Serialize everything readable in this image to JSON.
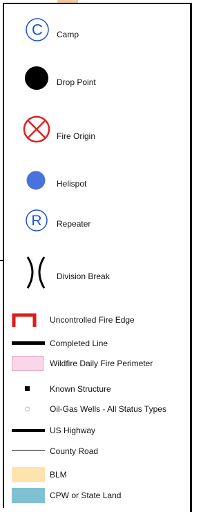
{
  "legend": {
    "items": [
      {
        "label": "Camp",
        "icon": "camp-c-circle-icon",
        "color": "#1f4fd6"
      },
      {
        "label": "Drop Point",
        "icon": "black-dot-icon",
        "color": "#000000"
      },
      {
        "label": "Fire Origin",
        "icon": "fire-origin-icon",
        "color": "#e02020"
      },
      {
        "label": "Helispot",
        "icon": "blue-dot-icon",
        "color": "#4a72dc"
      },
      {
        "label": "Repeater",
        "icon": "repeater-r-circle-icon",
        "color": "#1f4fd6"
      },
      {
        "label": "Division Break",
        "icon": "division-break-icon",
        "color": "#000000"
      },
      {
        "label": "Uncontrolled Fire Edge",
        "icon": "uncontrolled-edge-icon",
        "color": "#dd1c1c"
      },
      {
        "label": "Completed Line",
        "icon": "completed-line-icon",
        "color": "#000000"
      },
      {
        "label": "Wildfire Daily Fire Perimeter",
        "icon": "perimeter-swatch-icon",
        "color": "#f9d6e8"
      },
      {
        "label": "Known Structure",
        "icon": "square-icon",
        "color": "#000000"
      },
      {
        "label": "Oil-Gas Wells - All Status Types",
        "icon": "small-circle-icon",
        "color": "#b8b8b8"
      },
      {
        "label": "US Highway",
        "icon": "highway-line-icon",
        "color": "#000000"
      },
      {
        "label": "County Road",
        "icon": "thin-line-icon",
        "color": "#000000"
      },
      {
        "label": "BLM",
        "icon": "blm-swatch-icon",
        "color": "#fde3ad"
      },
      {
        "label": "CPW or State Land",
        "icon": "cpw-swatch-icon",
        "color": "#7fc1d1"
      }
    ]
  }
}
